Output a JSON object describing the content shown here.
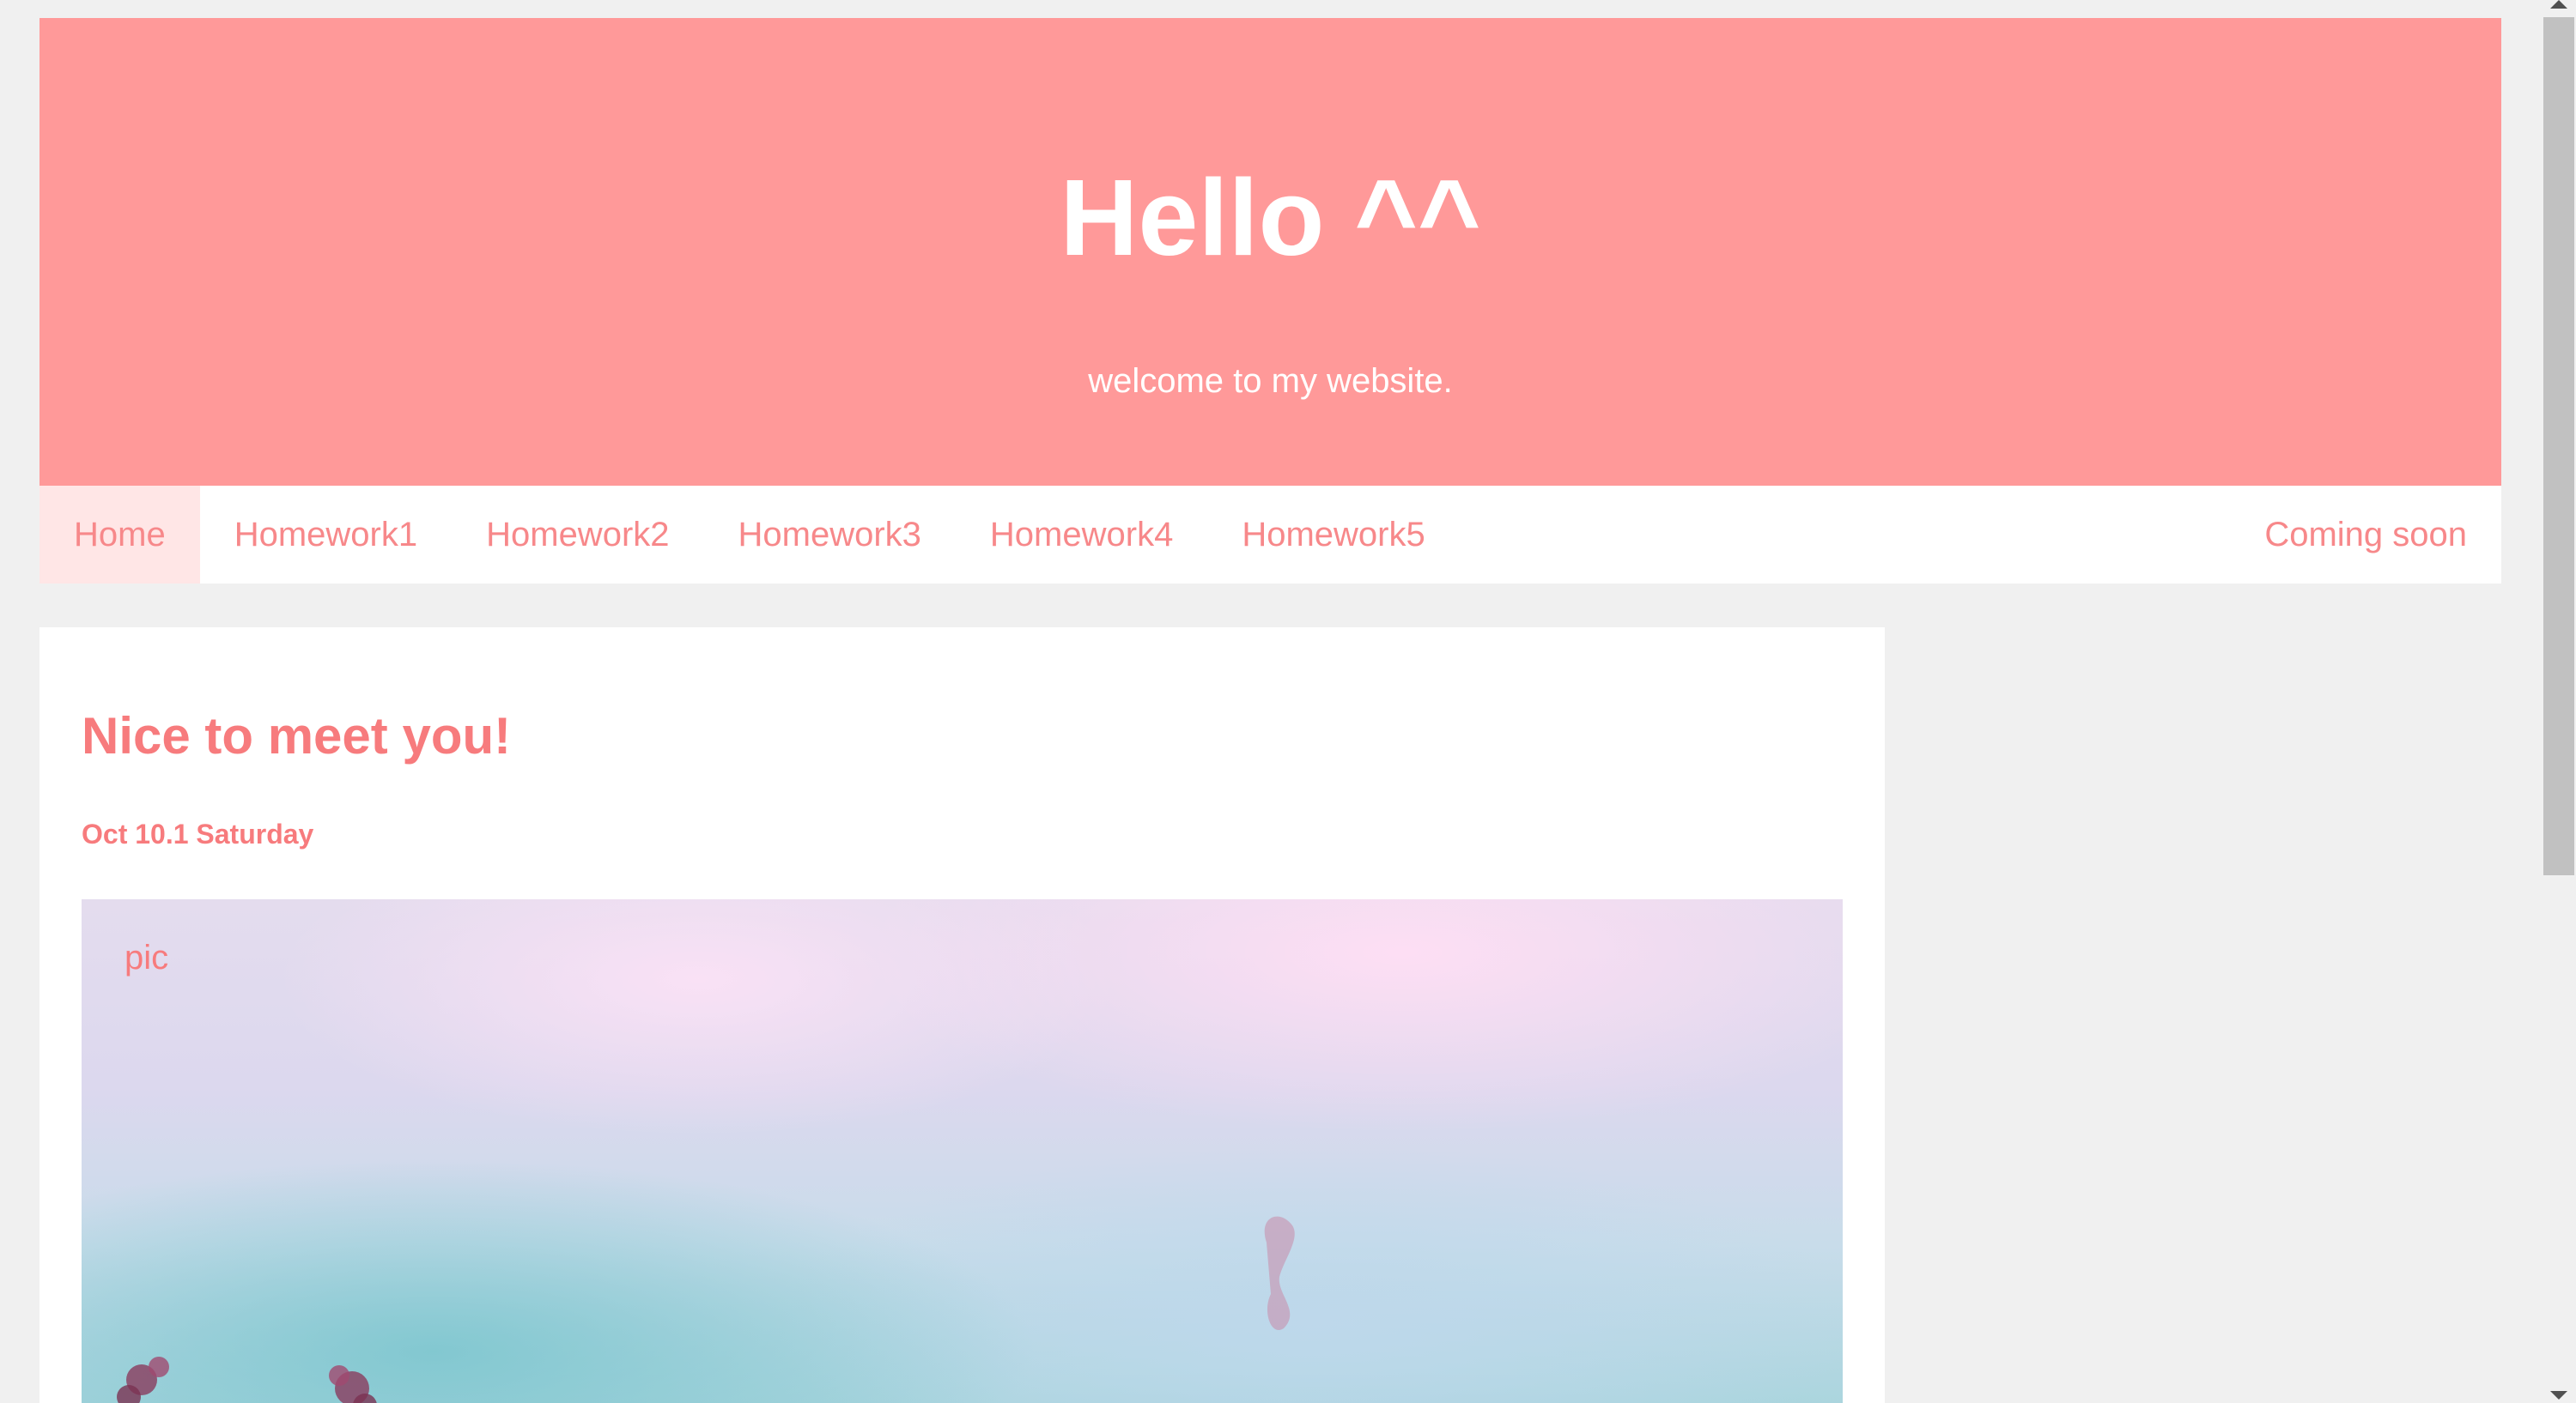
{
  "header": {
    "title": "Hello ^^",
    "subtitle": "welcome to my website."
  },
  "nav": {
    "items": [
      {
        "label": "Home",
        "active": true
      },
      {
        "label": "Homework1"
      },
      {
        "label": "Homework2"
      },
      {
        "label": "Homework3"
      },
      {
        "label": "Homework4"
      },
      {
        "label": "Homework5"
      }
    ],
    "right_item": {
      "label": "Coming soon"
    }
  },
  "post": {
    "title": "Nice to meet you!",
    "date": "Oct 10.1 Saturday",
    "image_label": "pic"
  },
  "colors": {
    "header_bg": "#ff9999",
    "accent": "#f77b7d",
    "page_bg": "#f0f0f0",
    "active_nav_bg": "#ffe6e6"
  }
}
